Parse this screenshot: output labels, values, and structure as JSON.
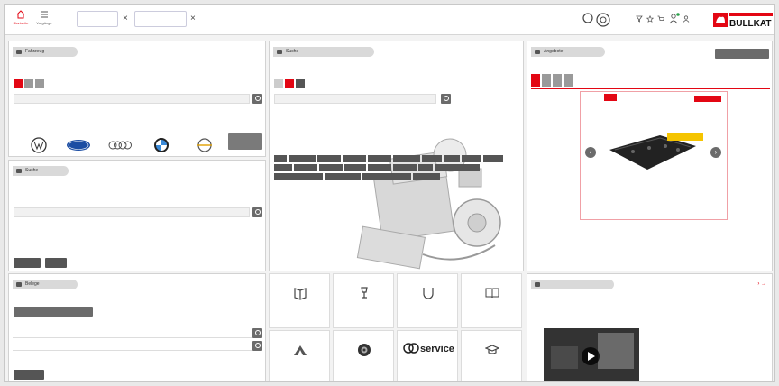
{
  "topbar": {
    "start_label": "Startseite",
    "history_label": "Vorgänge",
    "vehicle_tabs": [
      {
        "line1": "",
        "line2": ""
      },
      {
        "line1": "",
        "line2": ""
      }
    ],
    "right_label": "",
    "logo_text": "BULLKAT"
  },
  "vehicle_panel": {
    "title": "Fahrzeug",
    "tabs": [
      "",
      "",
      ""
    ],
    "search_value": "",
    "hint": "",
    "button_label": ""
  },
  "search_panel": {
    "title": "Suche",
    "tabs": [
      "",
      "",
      ""
    ],
    "search_value": "",
    "hint": "",
    "categories": [
      "",
      "",
      "",
      "",
      "",
      "",
      "",
      "",
      "",
      "",
      "",
      "",
      "",
      "",
      "",
      "",
      "",
      "",
      "",
      "",
      "",
      ""
    ]
  },
  "offers_panel": {
    "title": "Angebote",
    "top_button": "",
    "tabs": [
      "",
      "",
      "",
      ""
    ],
    "promo_badge": "",
    "promo_title": "",
    "promo_lines": [
      "",
      "",
      ""
    ],
    "promo_cta": "",
    "promo_caption": "",
    "promo_table": [
      {
        "label": "",
        "v1": "",
        "v2": ""
      },
      {
        "label": "",
        "v1": "",
        "v2": ""
      },
      {
        "label": "",
        "v1": "",
        "v2": ""
      },
      {
        "label": "",
        "v1": "",
        "v2": ""
      }
    ]
  },
  "lower_left": {
    "title": "Belege",
    "dropdown": "",
    "columns": [
      "",
      "",
      "",
      "",
      ""
    ],
    "rows": [
      {
        "c1": "",
        "c2": ""
      },
      {
        "c1": "",
        "c2": ""
      },
      {
        "c1": "",
        "c2": ""
      }
    ],
    "button_label": ""
  },
  "search_panel_left": {
    "title": "Suche",
    "search_value": "",
    "hint": "",
    "buttons": [
      "",
      ""
    ]
  },
  "tiles": [
    {
      "label": "",
      "icon": "book-tag-icon"
    },
    {
      "label": "",
      "icon": "lamp-icon"
    },
    {
      "label": "",
      "icon": "magnet-icon"
    },
    {
      "label": "",
      "icon": "open-book-icon"
    },
    {
      "label": "",
      "icon": "brand-logo-icon"
    },
    {
      "label": "",
      "icon": "tire-icon"
    },
    {
      "label": "",
      "icon": "service-logo-icon",
      "logo": "service"
    },
    {
      "label": "",
      "icon": "graduation-cap-icon"
    }
  ],
  "news_panel": {
    "title": "",
    "badge": "",
    "headline": "",
    "subline": "",
    "article_title": "",
    "article_text": "",
    "video_caption": "",
    "arrows": "› →"
  },
  "colors": {
    "accent": "#e30613",
    "button_gray": "#6b6b6b",
    "header_gray": "#d9d9d9"
  }
}
